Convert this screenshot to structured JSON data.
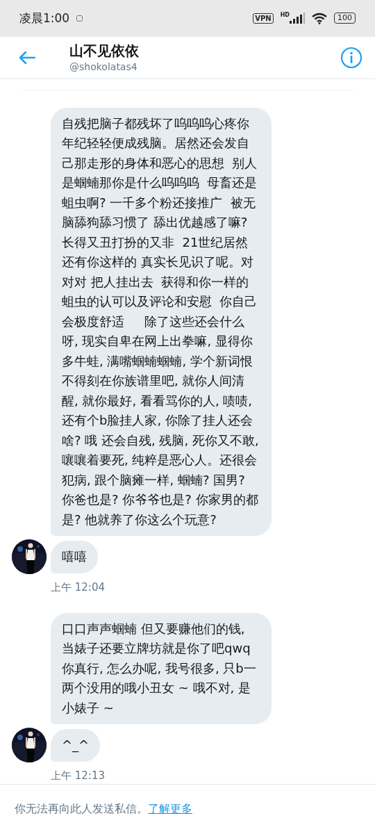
{
  "status_bar": {
    "time": "凌晨1:00",
    "vpn": "VPN",
    "network": "HD",
    "battery": "100"
  },
  "header": {
    "name": "山不见依依",
    "handle": "@shokolatas4"
  },
  "groups": [
    {
      "messages": [
        "自残把脑子都残坏了呜呜呜心疼你年纪轻轻便成残脑。居然还会发自己那走形的身体和恶心的思想  别人是蝈蝻那你是什么呜呜呜  母畜还是蛆虫啊? 一千多个粉还接推广  被无脑舔狗舔习惯了 舔出优越感了嘛? 长得又丑打扮的又非  21世纪居然还有你这样的 真实长见识了呢。对对对 把人挂出去  获得和你一样的蛆虫的认可以及评论和安慰  你自己会极度舒适     除了这些还会什么呀, 现实自卑在网上出拳嘛, 显得你多牛蛙, 满嘴蝈蝻蝈蝻, 学个新词恨不得刻在你族谱里吧, 就你人间清醒, 就你最好, 看看骂你的人, 啧啧, 还有个b脸挂人家, 你除了挂人还会啥? 哦 还会自残, 残脑, 死你又不敢, 嚷嚷着要死, 纯粹是恶心人。还很会犯病, 跟个脑瘫一样, 蝈蝻? 国男? 你爸也是? 你爷爷也是? 你家男的都是? 他就养了你这么个玩意?",
        "嘻嘻"
      ],
      "time": "上午 12:04"
    },
    {
      "messages": [
        "口口声声蝈蝻 但又要赚他们的钱, 当婊子还要立牌坊就是你了吧qwq 你真行, 怎么办呢, 我号很多, 只b一两个没用的哦小丑女 ~ 哦不对, 是小婊子 ~",
        "^_^"
      ],
      "time": "上午 12:13"
    }
  ],
  "footer": {
    "notice": "你无法再向此人发送私信。",
    "link": "了解更多"
  }
}
